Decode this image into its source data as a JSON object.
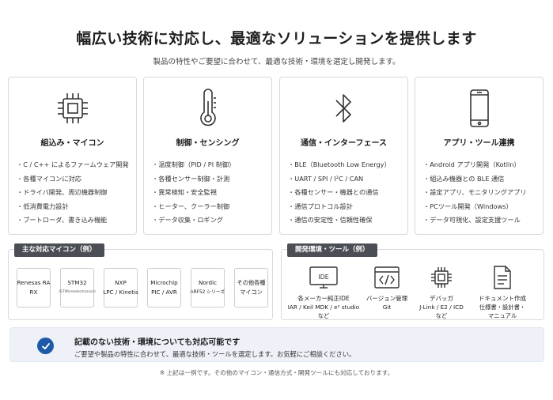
{
  "header": {
    "title": "幅広い技術に対応し、最適なソリューションを提供します",
    "subtitle": "製品の特性やご要望に合わせて、最適な技術・環境を選定し開発します。"
  },
  "cards": [
    {
      "icon": "chip-icon",
      "title": "組込み・マイコン",
      "items": [
        "C / C++ によるファームウェア開発",
        "各種マイコンに対応",
        "ドライバ開発、周辺機器制御",
        "低消費電力設計",
        "ブートローダ、書き込み機能"
      ]
    },
    {
      "icon": "thermometer-icon",
      "title": "制御・センシング",
      "items": [
        "温度制御（PID / PI 制御）",
        "各種センサー制御・計測",
        "異常検知・安全監視",
        "ヒーター、クーラー制御",
        "データ収集・ロギング"
      ]
    },
    {
      "icon": "bluetooth-icon",
      "title": "通信・インターフェース",
      "items": [
        "BLE（Bluetooth Low Energy）",
        "UART / SPI / I²C / CAN",
        "各種センサー・機器との通信",
        "通信プロトコル設計",
        "通信の安定性・信頼性確保"
      ]
    },
    {
      "icon": "smartphone-icon",
      "title": "アプリ・ツール連携",
      "items": [
        "Android アプリ開発（Kotlin）",
        "組込み機器との BLE 通信",
        "設定アプリ、モニタリングアプリ",
        "PCツール開発（Windows）",
        "データ可視化、設定支援ツール"
      ]
    }
  ],
  "mcu_panel": {
    "header": "主な対応マイコン（例）",
    "items": [
      {
        "line1": "Renesas RA",
        "line2": "RX",
        "small": false
      },
      {
        "line1": "STM32",
        "line2": "(STMicroelectronics)",
        "small": true
      },
      {
        "line1": "NXP",
        "line2": "LPC / Kinetis",
        "small": false
      },
      {
        "line1": "Microchip",
        "line2": "PIC / AVR",
        "small": false
      },
      {
        "line1": "Nordic",
        "line2": "nRF52 シリーズ",
        "small": false
      },
      {
        "line1": "その他各種",
        "line2": "マイコン",
        "small": false
      }
    ]
  },
  "tools_panel": {
    "header": "開発環境・ツール（例）",
    "items": [
      {
        "icon": "ide-icon",
        "icon_text": "IDE",
        "name": "各メーカー純正IDE",
        "desc1": "IAR / Keil MDK / e² studio",
        "desc2": "など"
      },
      {
        "icon": "code-icon",
        "name": "バージョン管理",
        "desc1": "Git",
        "desc2": ""
      },
      {
        "icon": "debugger-icon",
        "name": "デバッガ",
        "desc1": "J-Link / E2 / ICD",
        "desc2": "など"
      },
      {
        "icon": "document-icon",
        "name": "ドキュメント作成",
        "desc1": "仕様書・設計書・",
        "desc2": "マニュアル"
      }
    ]
  },
  "notice": {
    "title": "記載のない技術・環境についても対応可能です",
    "text": "ご要望や製品の特性に合わせて、最適な技術・ツールを選定します。お気軽にご相談ください。"
  },
  "footnote": "※ 上記は一例です。その他のマイコン・通信方式・開発ツールにも対応しております。",
  "colors": {
    "accent": "#1f5aa6",
    "panel_header": "#4b4f55",
    "border": "#d6d9de",
    "notice_bg": "#eef2f8"
  }
}
